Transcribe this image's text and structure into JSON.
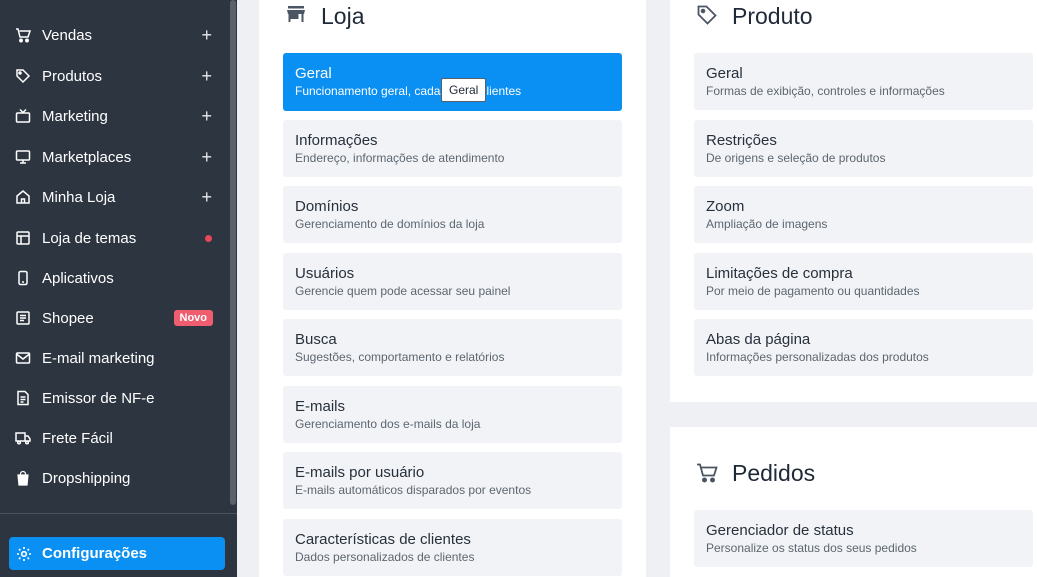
{
  "sidebar": {
    "items": [
      {
        "label": "Vendas",
        "icon": "cart-icon",
        "trail": "plus"
      },
      {
        "label": "Produtos",
        "icon": "tag-icon",
        "trail": "plus"
      },
      {
        "label": "Marketing",
        "icon": "tv-icon",
        "trail": "plus"
      },
      {
        "label": "Marketplaces",
        "icon": "monitor-icon",
        "trail": "plus"
      },
      {
        "label": "Minha Loja",
        "icon": "home-icon",
        "trail": "plus"
      },
      {
        "label": "Loja de temas",
        "icon": "layout-icon",
        "trail": "dot"
      },
      {
        "label": "Aplicativos",
        "icon": "smartphone-icon",
        "trail": ""
      },
      {
        "label": "Shopee",
        "icon": "shopee-icon",
        "trail": "badge",
        "badge": "Novo"
      },
      {
        "label": "E-mail marketing",
        "icon": "mail-icon",
        "trail": ""
      },
      {
        "label": "Emissor de NF-e",
        "icon": "document-icon",
        "trail": ""
      },
      {
        "label": "Frete Fácil",
        "icon": "truck-icon",
        "trail": ""
      },
      {
        "label": "Dropshipping",
        "icon": "bag-icon",
        "trail": ""
      }
    ],
    "plus_symbol": "+",
    "active_item": {
      "label": "Configurações",
      "icon": "gear-icon"
    }
  },
  "loja": {
    "title": "Loja",
    "cards": [
      {
        "title": "Geral",
        "desc": "Funcionamento geral, cadastro de clientes"
      },
      {
        "title": "Informações",
        "desc": "Endereço, informações de atendimento"
      },
      {
        "title": "Domínios",
        "desc": "Gerenciamento de domínios da loja"
      },
      {
        "title": "Usuários",
        "desc": "Gerencie quem pode acessar seu painel"
      },
      {
        "title": "Busca",
        "desc": "Sugestões, comportamento e relatórios"
      },
      {
        "title": "E-mails",
        "desc": "Gerenciamento dos e-mails da loja"
      },
      {
        "title": "E-mails por usuário",
        "desc": "E-mails automáticos disparados por eventos"
      },
      {
        "title": "Características de clientes",
        "desc": "Dados personalizados de clientes"
      }
    ]
  },
  "produto": {
    "title": "Produto",
    "cards": [
      {
        "title": "Geral",
        "desc": "Formas de exibição, controles e informações"
      },
      {
        "title": "Restrições",
        "desc": "De origens e seleção de produtos"
      },
      {
        "title": "Zoom",
        "desc": "Ampliação de imagens"
      },
      {
        "title": "Limitações de compra",
        "desc": "Por meio de pagamento ou quantidades"
      },
      {
        "title": "Abas da página",
        "desc": "Informações personalizadas dos produtos"
      }
    ]
  },
  "pedidos": {
    "title": "Pedidos",
    "cards": [
      {
        "title": "Gerenciador de status",
        "desc": "Personalize os status dos seus pedidos"
      }
    ]
  },
  "tooltip": {
    "text": "Geral"
  },
  "colors": {
    "sidebar_bg": "#2d3540",
    "accent": "#0a8ff3",
    "badge": "#ef5d6e",
    "dot": "#e5485b",
    "card_bg": "#f1f3f6"
  }
}
